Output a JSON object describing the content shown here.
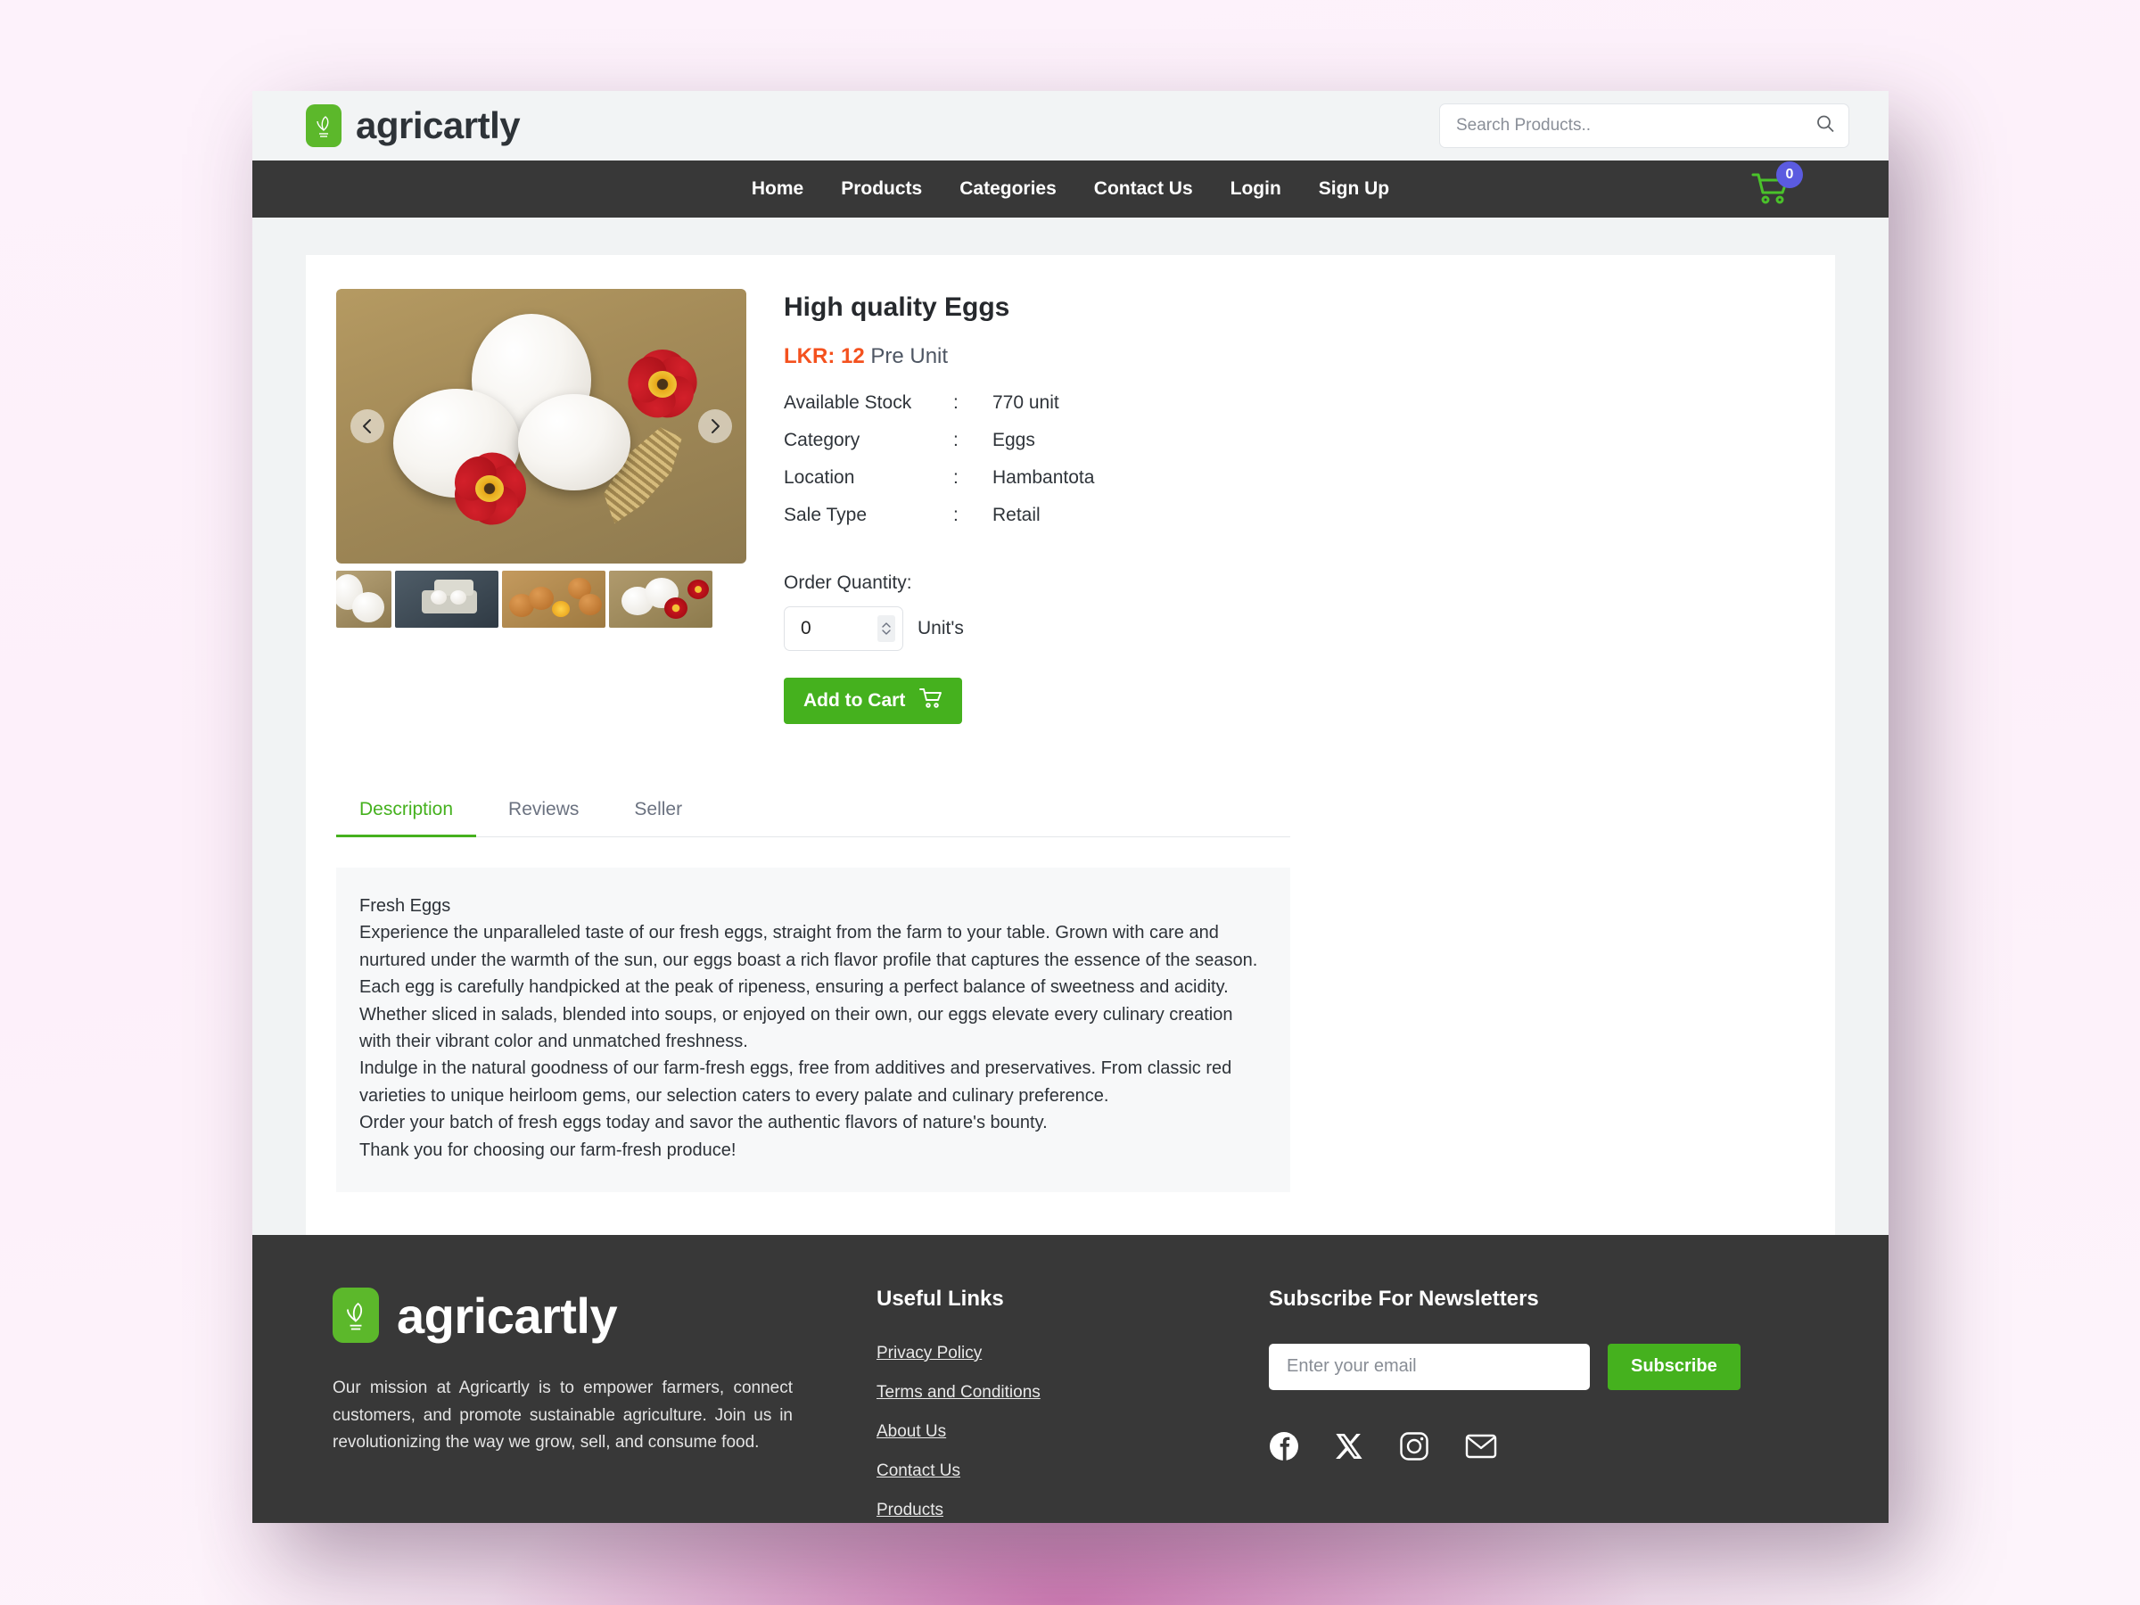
{
  "brand": {
    "name": "agricartly",
    "logo_icon": "corn-sack-icon",
    "accent": "#5cb82b"
  },
  "search": {
    "placeholder": "Search Products..",
    "value": "",
    "icon": "search-icon"
  },
  "nav": {
    "items": [
      {
        "label": "Home"
      },
      {
        "label": "Products"
      },
      {
        "label": "Categories"
      },
      {
        "label": "Contact Us"
      },
      {
        "label": "Login"
      },
      {
        "label": "Sign Up"
      }
    ],
    "cart": {
      "icon": "shopping-cart-icon",
      "count": "0",
      "badge_color": "#5b5be0"
    }
  },
  "product": {
    "title": "High quality Eggs",
    "price_currency": "LKR: 12",
    "price_unit": "Pre Unit",
    "price_color": "#f4511e",
    "specs": [
      {
        "key": "Available Stock",
        "sep": ":",
        "value": "770 unit"
      },
      {
        "key": "Category",
        "sep": ":",
        "value": "Eggs"
      },
      {
        "key": "Location",
        "sep": ":",
        "value": "Hambantota"
      },
      {
        "key": "Sale Type",
        "sep": ":",
        "value": "Retail"
      }
    ],
    "quantity_label": "Order Quantity:",
    "quantity_value": "0",
    "quantity_unit": "Unit's",
    "add_to_cart_label": "Add to Cart",
    "add_to_cart_icon": "cart-icon",
    "gallery": {
      "prev_icon": "chevron-left-icon",
      "next_icon": "chevron-right-icon",
      "main_alt": "White eggs on straw with red primrose flowers and wheat",
      "thumbs": [
        {
          "alt": "White eggs on straw"
        },
        {
          "alt": "Egg carton on dark slate surface"
        },
        {
          "alt": "Brown eggs with cracked yolk on straw"
        },
        {
          "alt": "White eggs with red flowers on straw"
        }
      ]
    }
  },
  "tabs": [
    {
      "label": "Description",
      "active": true
    },
    {
      "label": "Reviews",
      "active": false
    },
    {
      "label": "Seller",
      "active": false
    }
  ],
  "description": {
    "heading": "Fresh Eggs",
    "paragraphs": [
      "Experience the unparalleled taste of our fresh eggs, straight from the farm to your table. Grown with care and nurtured under the warmth of the sun, our eggs boast a rich flavor profile that captures the essence of the season.",
      "Each egg is carefully handpicked at the peak of ripeness, ensuring a perfect balance of sweetness and acidity. Whether sliced in salads, blended into soups, or enjoyed on their own, our eggs elevate every culinary creation with their vibrant color and unmatched freshness.",
      "Indulge in the natural goodness of our farm-fresh eggs, free from additives and preservatives. From classic red varieties to unique heirloom gems, our selection caters to every palate and culinary preference.",
      "Order your batch of fresh eggs today and savor the authentic flavors of nature's bounty.",
      "Thank you for choosing our farm-fresh produce!"
    ]
  },
  "footer": {
    "brand_name": "agricartly",
    "mission": "Our mission at Agricartly is to empower farmers, connect customers, and promote sustainable agriculture. Join us in revolutionizing the way we grow, sell, and consume food.",
    "links_heading": "Useful Links",
    "links": [
      {
        "label": "Privacy Policy"
      },
      {
        "label": "Terms and Conditions"
      },
      {
        "label": "About Us"
      },
      {
        "label": "Contact Us"
      },
      {
        "label": "Products"
      }
    ],
    "newsletter_heading": "Subscribe For Newsletters",
    "email_placeholder": "Enter your email",
    "email_value": "",
    "subscribe_label": "Subscribe",
    "socials": [
      {
        "icon": "facebook-icon"
      },
      {
        "icon": "x-twitter-icon"
      },
      {
        "icon": "instagram-icon"
      },
      {
        "icon": "email-icon"
      }
    ]
  }
}
